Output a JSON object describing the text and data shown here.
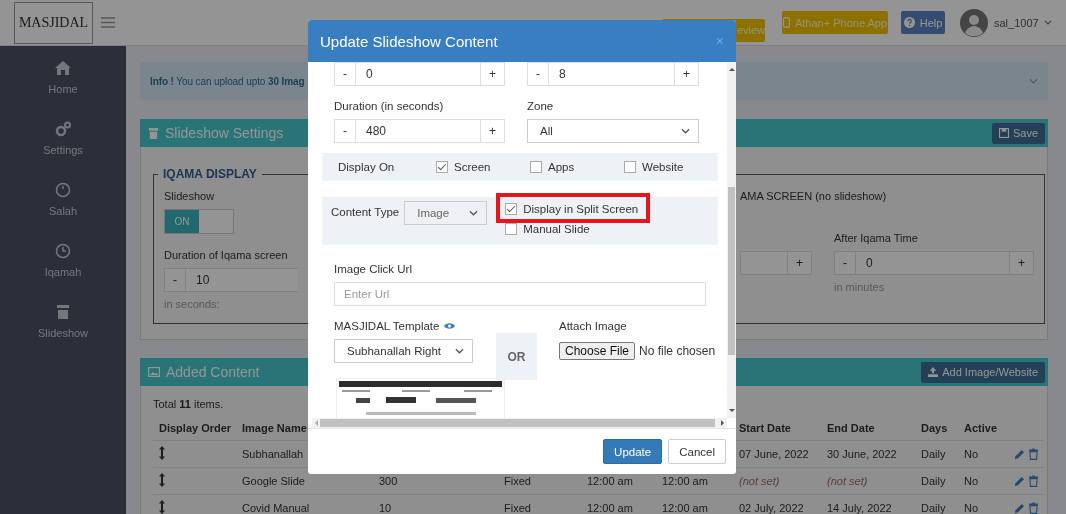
{
  "top_bar": {
    "logo": "MASJIDAL",
    "buttons": [
      {
        "label": "eview",
        "kind": "preview"
      },
      {
        "label": "Athan+ Phone App",
        "kind": "app"
      },
      {
        "label": "Help",
        "kind": "help"
      }
    ],
    "user": "sal_1007"
  },
  "sidebar": {
    "items": [
      {
        "label": "Home",
        "kind": "home"
      },
      {
        "label": "Settings",
        "kind": "settings"
      },
      {
        "label": "Salah",
        "kind": "salah"
      },
      {
        "label": "Iqamah",
        "kind": "iqamah"
      },
      {
        "label": "Slideshow",
        "kind": "slideshow"
      }
    ]
  },
  "info": "**Info !** You can upload upto **30 Imag**",
  "settings_panel": {
    "title": "Slideshow Settings",
    "save": "Save",
    "legend": "IQAMA DISPLAY",
    "slideshow": {
      "label": "Slideshow",
      "on": true,
      "text": "ON"
    },
    "duration": {
      "label": "Duration of Iqama screen",
      "minus": "-",
      "value": "10",
      "unit": "in seconds:"
    },
    "mode_text": "AMA SCREEN (no slideshow)",
    "hidden_stepper": {
      "plus": "+"
    },
    "after": {
      "label": "After Iqama Time",
      "minus": "-",
      "value": "0",
      "plus": "+",
      "unit": "in minutes"
    }
  },
  "added_panel": {
    "title": "Added Content",
    "add_button": "Add Image/Website",
    "total": "Total **11** items.",
    "columns": [
      "Display Order",
      "Image Name",
      null,
      null,
      null,
      null,
      "Start Date",
      "End Date",
      "Days",
      "Active"
    ],
    "rows": [
      {
        "cells": [
          "",
          "Subhanallah",
          null,
          null,
          null,
          null,
          "07 June, 2022",
          "30 June, 2022",
          "Daily",
          "No"
        ],
        "dates_set": true
      },
      {
        "cells": [
          "",
          "Google Slide",
          "300",
          "Fixed",
          "12:00 am",
          "12:00 am",
          "(not set)",
          "(not set)",
          "Daily",
          "No"
        ],
        "dates_set": false
      },
      {
        "cells": [
          "",
          "Covid Manual",
          "10",
          "Fixed",
          "12:00 am",
          "12:00 am",
          "02 July, 2022",
          "14 July, 2022",
          "Daily",
          "No"
        ],
        "dates_set": true
      }
    ]
  },
  "modal": {
    "title": "Update Slideshow Content",
    "close": "×",
    "steppers_top": [
      {
        "minus": "-",
        "value": "0",
        "plus": "+"
      },
      {
        "minus": "-",
        "value": "8",
        "plus": "+"
      }
    ],
    "duration": {
      "label": "Duration (in seconds)",
      "minus": "-",
      "value": "480",
      "plus": "+"
    },
    "zone": {
      "label": "Zone",
      "value": "All"
    },
    "display_on": {
      "label": "Display On",
      "options": [
        {
          "label": "Screen",
          "checked": true
        },
        {
          "label": "Apps",
          "checked": false
        },
        {
          "label": "Website",
          "checked": false
        }
      ]
    },
    "content_type": {
      "label": "Content Type",
      "value": "Image"
    },
    "split_screen": {
      "label": "Display in Split Screen",
      "checked": true,
      "highlighted": true
    },
    "manual_slide": {
      "label": "Manual Slide",
      "checked": false
    },
    "click_url": {
      "label": "Image Click Url",
      "placeholder": "Enter Url"
    },
    "template": {
      "label": "MASJIDAL Template",
      "value": "Subhanallah Right"
    },
    "or": "OR",
    "attach": {
      "label": "Attach Image",
      "button": "Choose File",
      "status": "No file chosen"
    },
    "buttons": [
      {
        "label": "Update",
        "kind": "primary"
      },
      {
        "label": "Cancel",
        "kind": "default"
      }
    ]
  }
}
